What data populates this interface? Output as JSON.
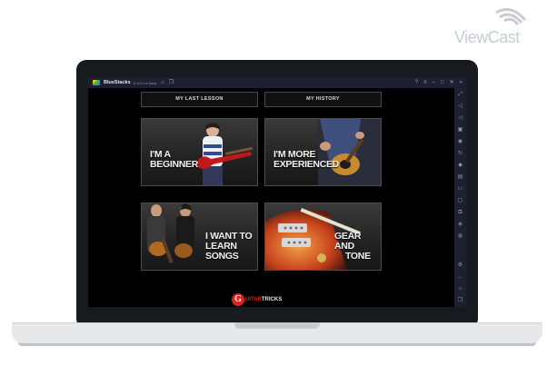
{
  "watermark": {
    "brand": "ViewCast"
  },
  "window": {
    "app_name": "BlueStacks",
    "version": "5.10.0.xx Beta",
    "icons": [
      "home-icon",
      "multi-instance-icon",
      "help-icon",
      "menu-icon",
      "minimize-icon",
      "restore-icon",
      "close-icon",
      "collapse-icon"
    ]
  },
  "sidebar": {
    "icons": [
      "fullscreen-icon",
      "volume-up-icon",
      "volume-down-icon",
      "media-icon",
      "screenshot-icon",
      "rotate-icon",
      "gamepad-icon",
      "apk-icon",
      "folder-icon",
      "copy-icon",
      "layers-icon",
      "eco-icon",
      "settings-icon",
      "back-icon",
      "home-icon",
      "recent-apps-icon"
    ]
  },
  "app": {
    "buttons": {
      "last_lesson": "MY LAST LESSON",
      "history": "MY HISTORY"
    },
    "tiles": {
      "beginner": {
        "line1": "I'M A",
        "line2": "BEGINNER"
      },
      "experienced": {
        "line1": "I'M MORE",
        "line2": "EXPERIENCED"
      },
      "songs": {
        "line1": "I WANT TO",
        "line2": "LEARN SONGS"
      },
      "gear": {
        "line1": "GEAR AND",
        "line2": "TONE"
      }
    },
    "logo": {
      "letter": "G",
      "part_a": "UITAR",
      "part_b": "TRICKS"
    }
  },
  "colors": {
    "accent_red": "#d4261c",
    "screen_bg": "#000000",
    "chrome": "#1c2030"
  }
}
